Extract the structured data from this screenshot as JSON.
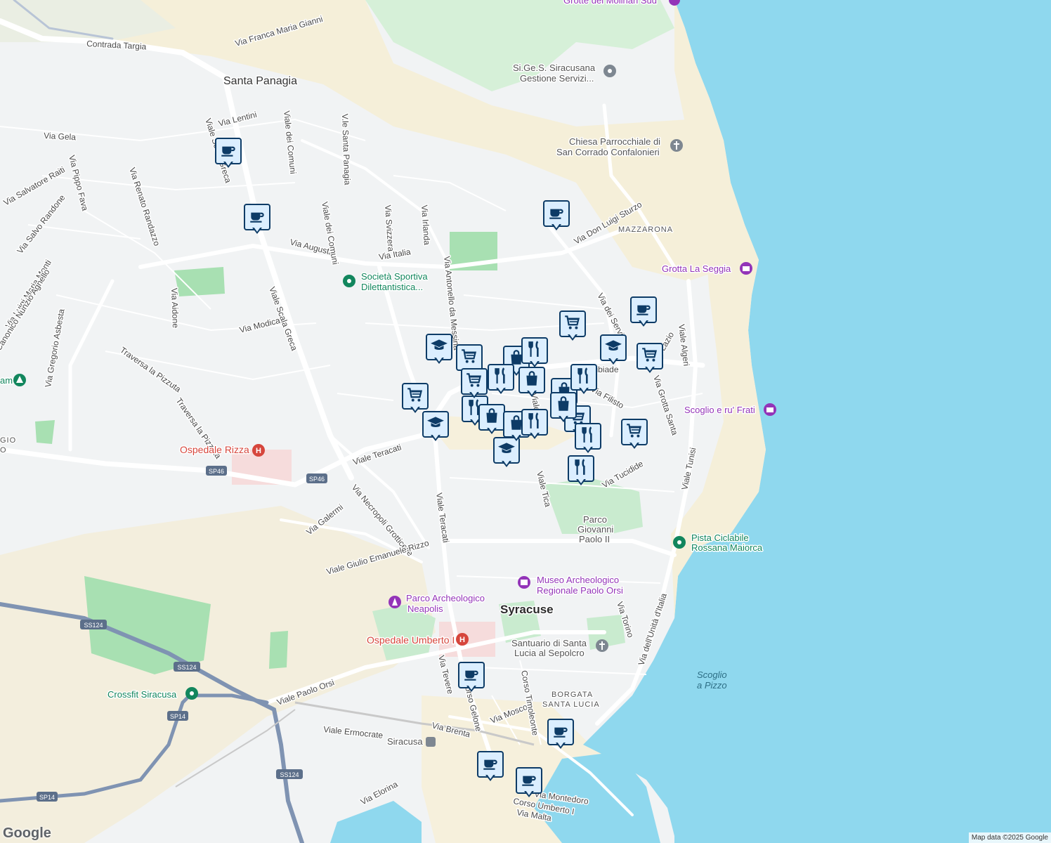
{
  "map": {
    "city": "Syracuse",
    "areas": [
      "Santa Panagia",
      "MAZZARONA",
      "BORGATA",
      "SANTA LUCIA",
      "GIO",
      "O"
    ],
    "streets": [
      "Contrada Targia",
      "Via Franca Maria Gianni",
      "Via Lentini",
      "Viale dei Comuni",
      "V.le Santa Panagia",
      "Via Gela",
      "Via Pippo Fava",
      "Via Salvatore Raiti",
      "Via Salvo Randone",
      "Via Renato Randazzo",
      "Via Luigi Maria Monti",
      "Canonico Nunzio Agnello",
      "Via Gregorio Asbesta",
      "Viale Scala Greca",
      "Via Augusta",
      "Via Svizzera",
      "Via Irlanda",
      "Via Italia",
      "Viale dei Comuni",
      "Via Aidone",
      "Via Modica",
      "Traversa la Pizzuta",
      "Traversa la Pizzuta",
      "Via Antonello da Messina",
      "Via Don Luigi Sturzo",
      "Via dei Servi",
      "Viale Algeri",
      "Viale Teracati",
      "Viale Scala Greca",
      "Via Necropoli Grotticelle",
      "Via Galermi",
      "Viale Giulio Emanuele Rizzo",
      "Viale Teracati",
      "Viale Tica",
      "Via Tucidide",
      "Viale Tunisi",
      "Via Grotta Santa",
      "Via Filisto",
      "Via Alcibiade",
      "Via Lazio",
      "Viale Paolo Orsi",
      "Viale Ermocrate",
      "Via Brenta",
      "Via Mosco",
      "Corso Timoleonte",
      "Via Torino",
      "Via dell'Unità d'Italia",
      "Via Elorina",
      "Via Montedoro",
      "Corso Umberto I",
      "Via Malta",
      "Via Tevere",
      "Corso Gelone",
      "Viale Filisto"
    ],
    "road_shields": [
      "SP46",
      "SP46",
      "SS124",
      "SS124",
      "SS124",
      "SP14",
      "SP14"
    ],
    "pois": {
      "grotte": "Grotte dei Molinari Sud",
      "sigesi_1": "Si.Ge.S. Siracusana",
      "sigesi_2": "Gestione Servizi...",
      "chiesa_1": "Chiesa Parrocchiale di",
      "chiesa_2": "San Corrado Confalonieri",
      "seggia": "Grotta La Seggia",
      "societa_1": "Società Sportiva",
      "societa_2": "Dilettantistica...",
      "scoglio_frati": "Scoglio e ru' Frati",
      "ospedale_rizza": "Ospedale Rizza",
      "parco_1": "Parco",
      "parco_2": "Giovanni",
      "parco_3": "Paolo II",
      "pista_1": "Pista Ciclabile",
      "pista_2": "Rossana Maiorca",
      "museo_1": "Museo Archeologico",
      "museo_2": "Regionale Paolo Orsi",
      "neapolis_1": "Parco Archeologico",
      "neapolis_2": "Neapolis",
      "umberto": "Ospedale Umberto I",
      "santuario_1": "Santuario di Santa",
      "santuario_2": "Lucia al Sepolcro",
      "crossfit": "Crossfit Siracusa",
      "station": "Siracusa",
      "scoglio_pizzo_1": "Scoglio",
      "scoglio_pizzo_2": "a Pizzo",
      "am": "am"
    },
    "markers": [
      {
        "type": "coffee-icon"
      },
      {
        "type": "coffee-icon"
      },
      {
        "type": "coffee-icon"
      },
      {
        "type": "coffee-icon"
      },
      {
        "type": "cart-icon"
      },
      {
        "type": "graduation-cap-icon"
      },
      {
        "type": "cart-icon"
      },
      {
        "type": "cart-icon"
      },
      {
        "type": "graduation-cap-icon"
      },
      {
        "type": "cart-icon"
      },
      {
        "type": "cutlery-icon"
      },
      {
        "type": "bag-icon"
      },
      {
        "type": "cutlery-icon"
      },
      {
        "type": "cutlery-icon"
      },
      {
        "type": "bag-icon"
      },
      {
        "type": "bag-icon"
      },
      {
        "type": "cart-icon"
      },
      {
        "type": "graduation-cap-icon"
      },
      {
        "type": "cart-icon"
      },
      {
        "type": "cutlery-icon"
      },
      {
        "type": "cutlery-icon"
      },
      {
        "type": "cart-icon"
      },
      {
        "type": "coffee-icon"
      },
      {
        "type": "coffee-icon"
      },
      {
        "type": "coffee-icon"
      },
      {
        "type": "coffee-icon"
      }
    ],
    "colors": {
      "sea": "#8fd8ee",
      "land": "#f1f3f4",
      "park": "#c9ebcf",
      "sand": "#f5efd9",
      "marker_border": "#0d3b66",
      "marker_fill": "#dbeeff",
      "highway": "#7f93b2"
    }
  },
  "logo": "Google",
  "attribution": "Map data ©2025 Google"
}
